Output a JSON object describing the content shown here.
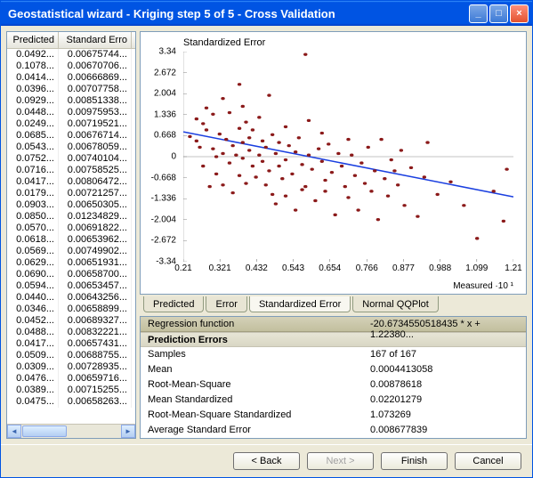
{
  "window": {
    "title": "Geostatistical wizard - Kriging step 5 of 5 - Cross Validation"
  },
  "table": {
    "columns": [
      "Predicted",
      "Standard Erro"
    ],
    "rows": [
      [
        "0.0492...",
        "0.00675744..."
      ],
      [
        "0.1078...",
        "0.00670706..."
      ],
      [
        "0.0414...",
        "0.00666869..."
      ],
      [
        "0.0396...",
        "0.00707758..."
      ],
      [
        "0.0929...",
        "0.00851338..."
      ],
      [
        "0.0448...",
        "0.00975953..."
      ],
      [
        "0.0249...",
        "0.00719521..."
      ],
      [
        "0.0685...",
        "0.00676714..."
      ],
      [
        "0.0543...",
        "0.00678059..."
      ],
      [
        "0.0752...",
        "0.00740104..."
      ],
      [
        "0.0716...",
        "0.00758525..."
      ],
      [
        "0.0417...",
        "0.00806472..."
      ],
      [
        "0.0179...",
        "0.00721257..."
      ],
      [
        "0.0903...",
        "0.00650305..."
      ],
      [
        "0.0850...",
        "0.01234829..."
      ],
      [
        "0.0570...",
        "0.00691822..."
      ],
      [
        "0.0618...",
        "0.00653962..."
      ],
      [
        "0.0569...",
        "0.00749902..."
      ],
      [
        "0.0629...",
        "0.00651931..."
      ],
      [
        "0.0690...",
        "0.00658700..."
      ],
      [
        "0.0594...",
        "0.00653457..."
      ],
      [
        "0.0440...",
        "0.00643256..."
      ],
      [
        "0.0346...",
        "0.00658899..."
      ],
      [
        "0.0452...",
        "0.00689327..."
      ],
      [
        "0.0488...",
        "0.00832221..."
      ],
      [
        "0.0417...",
        "0.00657431..."
      ],
      [
        "0.0509...",
        "0.00688755..."
      ],
      [
        "0.0309...",
        "0.00728935..."
      ],
      [
        "0.0476...",
        "0.00659716..."
      ],
      [
        "0.0389...",
        "0.00715255..."
      ],
      [
        "0.0475...",
        "0.00658263..."
      ]
    ]
  },
  "chart_data": {
    "type": "scatter",
    "title": "Standardized Error",
    "xlabel": "Measured ·10 ¹",
    "ylabel": "",
    "xlim": [
      0.21,
      1.21
    ],
    "ylim": [
      -3.34,
      3.34
    ],
    "xticks": [
      0.21,
      0.321,
      0.432,
      0.543,
      0.654,
      0.766,
      0.877,
      0.988,
      1.099,
      1.21
    ],
    "yticks": [
      -3.34,
      -2.672,
      -2.004,
      -1.336,
      -0.668,
      0,
      0.668,
      1.336,
      2.004,
      2.672,
      3.34
    ],
    "regression": {
      "slope": -20.6734550518435,
      "intercept": 1.2238
    },
    "points": [
      [
        0.23,
        0.64
      ],
      [
        0.25,
        1.2
      ],
      [
        0.25,
        0.5
      ],
      [
        0.26,
        0.3
      ],
      [
        0.27,
        1.05
      ],
      [
        0.27,
        -0.3
      ],
      [
        0.28,
        0.85
      ],
      [
        0.29,
        -0.95
      ],
      [
        0.3,
        0.25
      ],
      [
        0.3,
        1.35
      ],
      [
        0.31,
        0.0
      ],
      [
        0.31,
        -0.55
      ],
      [
        0.32,
        0.72
      ],
      [
        0.33,
        0.1
      ],
      [
        0.33,
        -0.9
      ],
      [
        0.34,
        0.55
      ],
      [
        0.35,
        1.4
      ],
      [
        0.35,
        -0.2
      ],
      [
        0.36,
        0.35
      ],
      [
        0.36,
        -1.15
      ],
      [
        0.37,
        0.05
      ],
      [
        0.38,
        0.9
      ],
      [
        0.38,
        -0.6
      ],
      [
        0.39,
        0.45
      ],
      [
        0.39,
        -0.05
      ],
      [
        0.4,
        1.1
      ],
      [
        0.4,
        -0.85
      ],
      [
        0.41,
        0.2
      ],
      [
        0.41,
        0.6
      ],
      [
        0.42,
        -0.3
      ],
      [
        0.42,
        0.85
      ],
      [
        0.43,
        -0.65
      ],
      [
        0.44,
        0.05
      ],
      [
        0.44,
        1.25
      ],
      [
        0.45,
        -0.15
      ],
      [
        0.45,
        0.5
      ],
      [
        0.46,
        -0.9
      ],
      [
        0.46,
        0.3
      ],
      [
        0.47,
        -0.45
      ],
      [
        0.48,
        0.7
      ],
      [
        0.48,
        -1.2
      ],
      [
        0.49,
        0.1
      ],
      [
        0.5,
        0.45
      ],
      [
        0.5,
        -0.3
      ],
      [
        0.51,
        -0.7
      ],
      [
        0.52,
        0.95
      ],
      [
        0.52,
        -0.1
      ],
      [
        0.53,
        0.35
      ],
      [
        0.54,
        -0.55
      ],
      [
        0.55,
        0.15
      ],
      [
        0.55,
        -1.7
      ],
      [
        0.56,
        0.6
      ],
      [
        0.57,
        -0.25
      ],
      [
        0.58,
        3.25
      ],
      [
        0.58,
        -0.95
      ],
      [
        0.59,
        0.05
      ],
      [
        0.6,
        -0.4
      ],
      [
        0.61,
        -1.4
      ],
      [
        0.62,
        0.25
      ],
      [
        0.63,
        -0.15
      ],
      [
        0.64,
        -0.75
      ],
      [
        0.65,
        0.4
      ],
      [
        0.66,
        -0.5
      ],
      [
        0.67,
        -1.85
      ],
      [
        0.68,
        0.1
      ],
      [
        0.69,
        -0.3
      ],
      [
        0.7,
        -0.95
      ],
      [
        0.71,
        -1.3
      ],
      [
        0.72,
        0.05
      ],
      [
        0.73,
        -0.6
      ],
      [
        0.74,
        -1.7
      ],
      [
        0.75,
        -0.2
      ],
      [
        0.76,
        -0.85
      ],
      [
        0.77,
        0.3
      ],
      [
        0.78,
        -1.1
      ],
      [
        0.79,
        -0.45
      ],
      [
        0.8,
        -2.0
      ],
      [
        0.81,
        0.55
      ],
      [
        0.82,
        -0.7
      ],
      [
        0.83,
        -1.25
      ],
      [
        0.84,
        -0.1
      ],
      [
        0.86,
        -0.9
      ],
      [
        0.88,
        -1.55
      ],
      [
        0.9,
        -0.35
      ],
      [
        0.92,
        -1.9
      ],
      [
        0.94,
        -0.65
      ],
      [
        0.98,
        -1.2
      ],
      [
        1.02,
        -0.8
      ],
      [
        1.06,
        -1.55
      ],
      [
        1.1,
        -2.6
      ],
      [
        1.15,
        -1.1
      ],
      [
        1.18,
        -2.05
      ],
      [
        1.19,
        -0.4
      ],
      [
        0.47,
        1.95
      ],
      [
        0.39,
        1.6
      ],
      [
        0.33,
        1.85
      ],
      [
        0.38,
        2.3
      ],
      [
        0.59,
        1.15
      ],
      [
        0.63,
        0.75
      ],
      [
        0.52,
        -1.25
      ],
      [
        0.57,
        -1.05
      ],
      [
        0.49,
        -1.5
      ],
      [
        0.87,
        0.2
      ],
      [
        0.95,
        0.45
      ],
      [
        0.28,
        1.55
      ],
      [
        0.64,
        -1.1
      ],
      [
        0.71,
        0.55
      ],
      [
        0.85,
        -0.45
      ]
    ]
  },
  "tabs": {
    "items": [
      "Predicted",
      "Error",
      "Standardized Error",
      "Normal QQPlot"
    ],
    "active": 2
  },
  "info": {
    "regression_label": "Regression function",
    "regression_value": "-20.6734550518435 * x + 1.22380...",
    "section": "Prediction Errors",
    "rows": [
      {
        "k": "Samples",
        "v": "167 of 167"
      },
      {
        "k": "Mean",
        "v": "0.0004413058"
      },
      {
        "k": "Root-Mean-Square",
        "v": "0.00878618"
      },
      {
        "k": "Mean Standardized",
        "v": "0.02201279"
      },
      {
        "k": "Root-Mean-Square Standardized",
        "v": "1.073269"
      },
      {
        "k": "Average Standard Error",
        "v": "0.008677839"
      }
    ]
  },
  "buttons": {
    "back": "< Back",
    "next": "Next >",
    "finish": "Finish",
    "cancel": "Cancel"
  }
}
